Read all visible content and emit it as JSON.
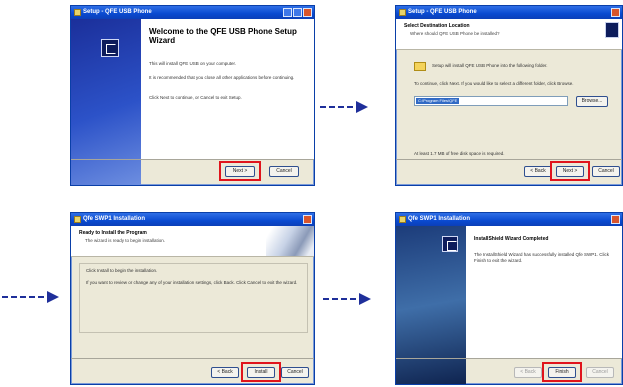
{
  "colors": {
    "highlight": "#e0141c",
    "arrow": "#1f2f9a",
    "titlebar": "#0a4ad0"
  },
  "step1": {
    "title": "Setup - QFE USB Phone",
    "heading": "Welcome to the QFE USB Phone Setup Wizard",
    "p1": "This will install QFE USB on your computer.",
    "p2": "It is recommended that you close all other applications before continuing.",
    "p3": "Click Next to continue, or Cancel to exit Setup.",
    "next": "Next >",
    "cancel": "Cancel"
  },
  "step2": {
    "title": "Setup - QFE USB Phone",
    "heading": "Select Destination Location",
    "subheading": "Where should QFE USB Phone be installed?",
    "info": "Setup will install QFE USB Phone into the following folder.",
    "instruction": "To continue, click Next. If you would like to select a different folder, click Browse.",
    "path": "C:\\Program Files\\QFE",
    "browse": "Browse...",
    "space": "At least 1.7 MB of free disk space is required.",
    "back": "< Back",
    "next": "Next >",
    "cancel": "Cancel"
  },
  "step3": {
    "title": "Qfe SWP1 Installation",
    "heading": "Ready to Install the Program",
    "subheading": "The wizard is ready to begin installation.",
    "p1": "Click Install to begin the installation.",
    "p2": "If you want to review or change any of your installation settings, click Back. Click Cancel to exit the wizard.",
    "back": "< Back",
    "install": "Install",
    "cancel": "Cancel"
  },
  "step4": {
    "title": "Qfe SWP1 Installation",
    "heading": "InstallShield Wizard Completed",
    "p1": "The InstallShield Wizard has successfully installed Qfe SWP1. Click Finish to exit the wizard.",
    "back": "< Back",
    "finish": "Finish",
    "cancel": "Cancel"
  }
}
